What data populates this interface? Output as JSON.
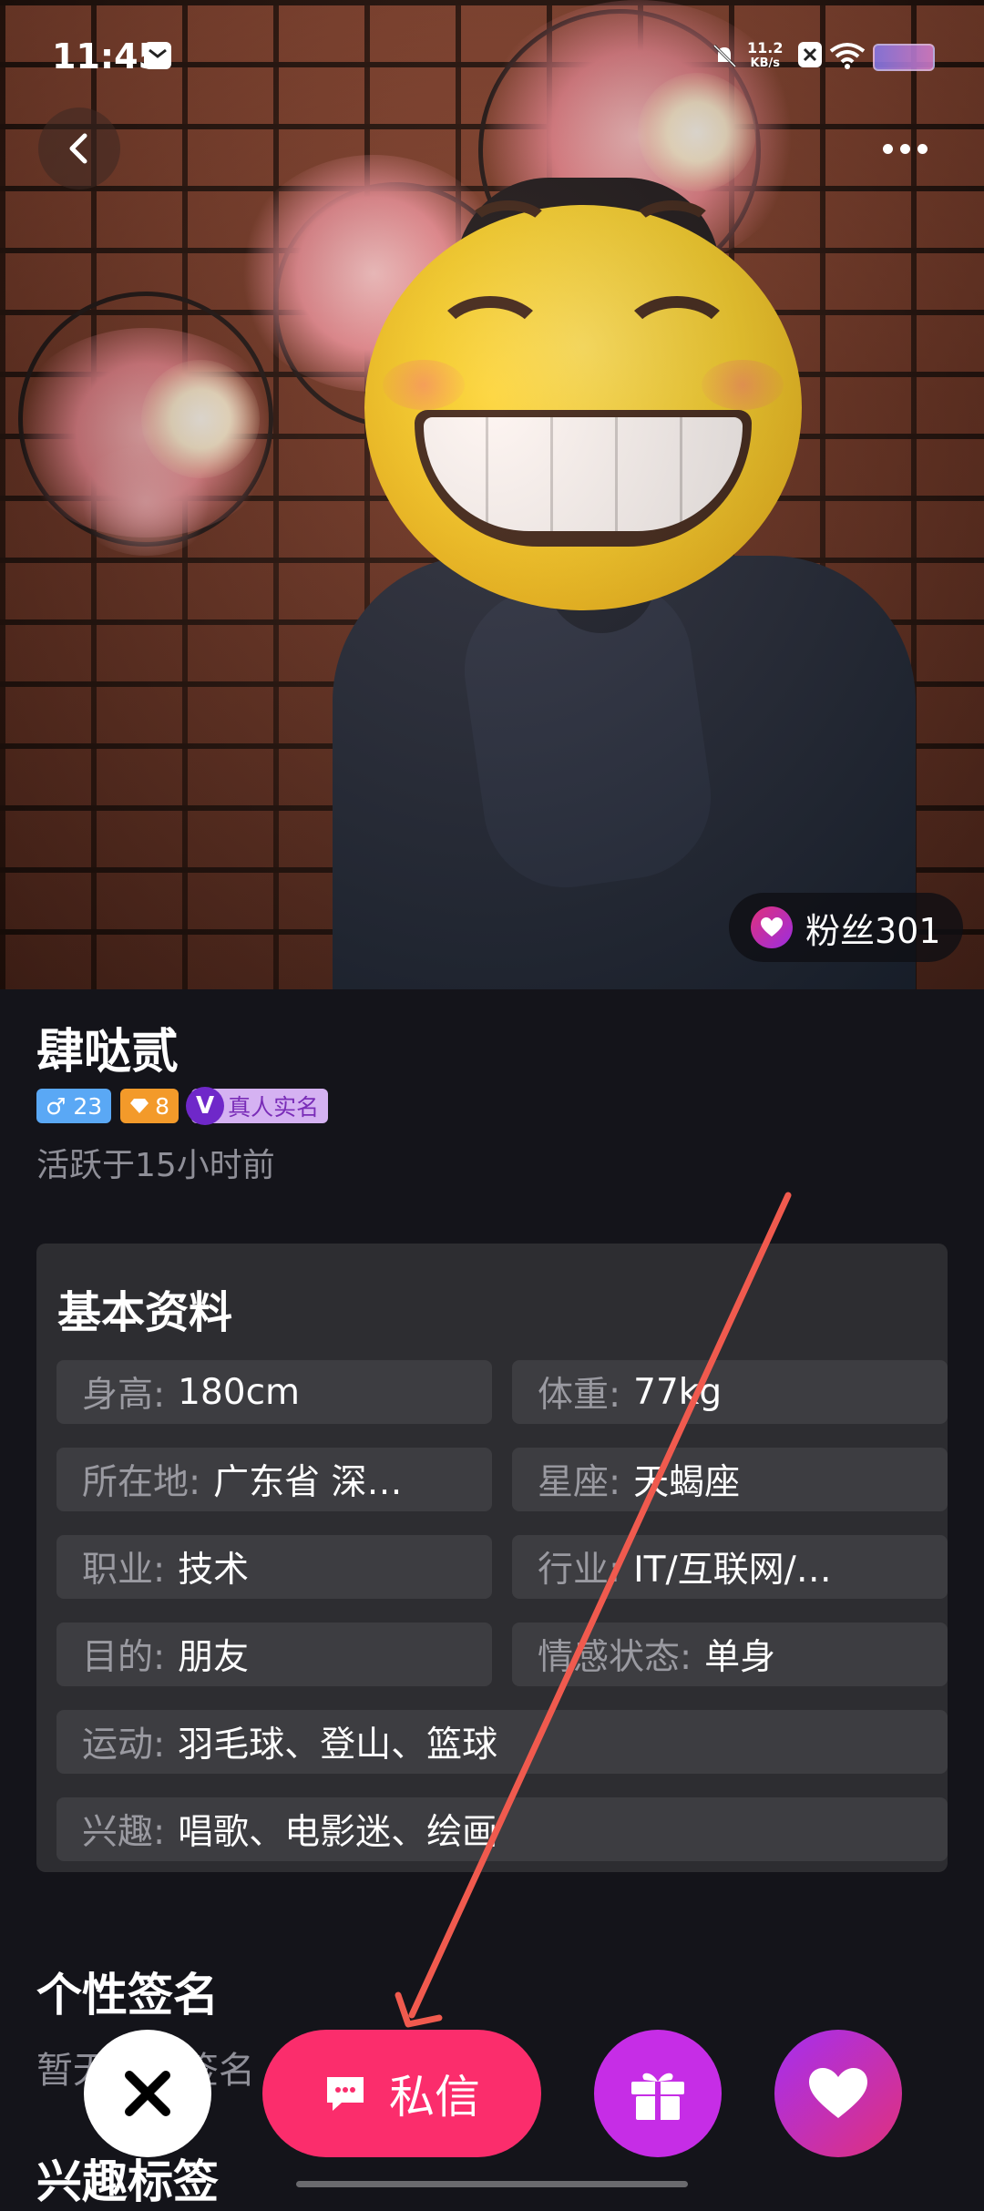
{
  "status_bar": {
    "time": "11:45",
    "net_speed_value": "11.2",
    "net_speed_unit": "KB/s",
    "icons": [
      "message-icon",
      "mute-icon",
      "close-box-icon",
      "wifi-icon",
      "battery-icon"
    ]
  },
  "header": {
    "back_icon": "back-arrow-icon",
    "more_icon": "more-dots-icon",
    "fans_label": "粉丝301"
  },
  "profile": {
    "name": "肆哒贰",
    "gender_age": "♂ 23",
    "level": "8",
    "verify_badge_letter": "V",
    "verify_label": "真人实名",
    "last_active": "活跃于15小时前"
  },
  "basic_info": {
    "title": "基本资料",
    "fields": [
      {
        "key": "身高:",
        "value": "180cm"
      },
      {
        "key": "体重:",
        "value": "77kg"
      },
      {
        "key": "所在地:",
        "value": "广东省 深…"
      },
      {
        "key": "星座:",
        "value": "天蝎座"
      },
      {
        "key": "职业:",
        "value": "技术"
      },
      {
        "key": "行业:",
        "value": "IT/互联网/…"
      },
      {
        "key": "目的:",
        "value": "朋友"
      },
      {
        "key": "情感状态:",
        "value": "单身"
      },
      {
        "key": "运动:",
        "value": "羽毛球、登山、篮球"
      },
      {
        "key": "兴趣:",
        "value": "唱歌、电影迷、绘画"
      }
    ]
  },
  "signature": {
    "title": "个性签名",
    "text": "暂无个性签名"
  },
  "interests_title": "兴趣标签",
  "actions": {
    "dislike_icon": "close-x-icon",
    "message_label": "私信",
    "message_icon": "chat-bubble-icon",
    "gift_icon": "gift-icon",
    "like_icon": "heart-icon"
  },
  "colors": {
    "background": "#14141a",
    "card": "#2d2d31",
    "field": "#3d3d41",
    "message_button": "#fb2d6c",
    "gift_button": "#c62de6",
    "annotation_arrow": "#f05a4e"
  }
}
